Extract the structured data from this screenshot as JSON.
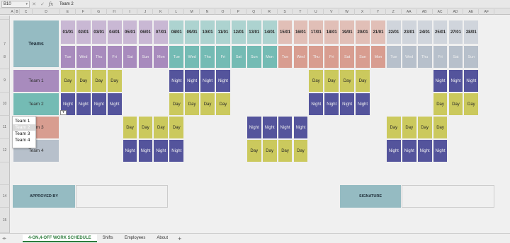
{
  "formula_bar": {
    "cell_ref": "B10",
    "value": "Team 2",
    "cancel_icon": "✕",
    "confirm_icon": "✓",
    "fx": "fx"
  },
  "columns": [
    "A",
    "B",
    "C",
    "D",
    "E",
    "F",
    "G",
    "H",
    "I",
    "J",
    "K",
    "L",
    "M",
    "N",
    "O",
    "P",
    "Q",
    "R",
    "S",
    "T",
    "U",
    "V",
    "W",
    "X",
    "Y",
    "Z",
    "AA",
    "AB",
    "AC",
    "AD",
    "AE",
    "AF"
  ],
  "rows": [
    "7",
    "8",
    "9",
    "10",
    "11",
    "12",
    "13",
    "14",
    "15"
  ],
  "header": {
    "teams_label": "Teams"
  },
  "dates": [
    "01/01",
    "02/01",
    "03/01",
    "04/01",
    "05/01",
    "06/01",
    "07/01",
    "08/01",
    "09/01",
    "10/01",
    "11/01",
    "12/01",
    "13/01",
    "14/01",
    "15/01",
    "16/01",
    "17/01",
    "18/01",
    "19/01",
    "20/01",
    "21/01",
    "22/01",
    "23/01",
    "24/01",
    "25/01",
    "27/01",
    "28/01"
  ],
  "weekdays": [
    "Tue",
    "Wed",
    "Thu",
    "Fri",
    "Sat",
    "Sun",
    "Mon",
    "Tue",
    "Wed",
    "Thu",
    "Fri",
    "Sat",
    "Sun",
    "Mon",
    "Tue",
    "Wed",
    "Thu",
    "Fri",
    "Sat",
    "Sun",
    "Mon",
    "Tue",
    "Wed",
    "Thu",
    "Fri",
    "Sat",
    "Sun"
  ],
  "week_colors": [
    "#b394c9",
    "#7cc7c0",
    "#e6a79a",
    "#c3cdd8"
  ],
  "teams": [
    {
      "name": "Team 1",
      "color": "#b394c9",
      "shifts": [
        "Day",
        "Day",
        "Day",
        "Day",
        "",
        "",
        "",
        "Night",
        "Night",
        "Night",
        "Night",
        "",
        "",
        "",
        "",
        "",
        "Day",
        "Day",
        "Day",
        "Day",
        "",
        "",
        "",
        "",
        "Night",
        "Night",
        "Night"
      ]
    },
    {
      "name": "Team 2",
      "color": "#7cc7c0",
      "shifts": [
        "Night",
        "Night",
        "Night",
        "Night",
        "",
        "",
        "",
        "Day",
        "Day",
        "Day",
        "Day",
        "",
        "",
        "",
        "",
        "",
        "Night",
        "Night",
        "Night",
        "Night",
        "",
        "",
        "",
        "",
        "Day",
        "Day",
        "Day"
      ]
    },
    {
      "name": "Team 3",
      "color": "#e6a79a",
      "shifts": [
        "",
        "",
        "",
        "",
        "Day",
        "Day",
        "Day",
        "Day",
        "",
        "",
        "",
        "",
        "Night",
        "Night",
        "Night",
        "Night",
        "",
        "",
        "",
        "",
        "",
        "Day",
        "Day",
        "Day",
        "Day",
        "",
        ""
      ]
    },
    {
      "name": "Team 4",
      "color": "#c3cdd8",
      "shifts": [
        "",
        "",
        "",
        "",
        "Night",
        "Night",
        "Night",
        "Night",
        "",
        "",
        "",
        "",
        "Day",
        "Day",
        "Day",
        "Day",
        "",
        "",
        "",
        "",
        "",
        "Night",
        "Night",
        "Night",
        "Night",
        "",
        ""
      ]
    }
  ],
  "dropdown": {
    "arrow": "▾",
    "options": [
      "Team 1",
      "Team 2",
      "Team 3",
      "Team 4"
    ],
    "highlighted": "Team 2"
  },
  "approval": {
    "approved_by": "APPROVED BY",
    "signature": "SIGNATURE"
  },
  "sheet_tabs": [
    "4-ON,4-OFF WORK SCHEDULE",
    "Shifts",
    "Employees",
    "About"
  ],
  "active_tab": "4-ON,4-OFF WORK SCHEDULE",
  "add_tab": "+",
  "colors": {
    "day": "#d8d663",
    "night": "#5a5aa6",
    "approval_bg": "#9fc7cf"
  }
}
